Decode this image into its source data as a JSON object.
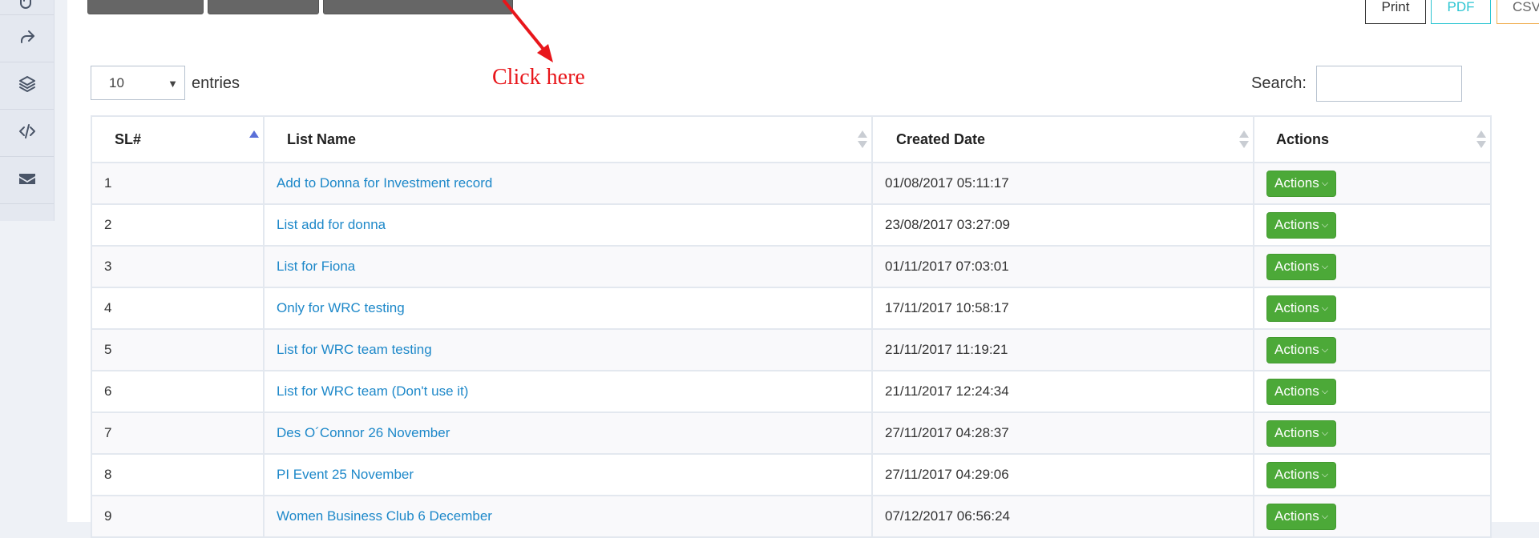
{
  "sidebar": {
    "icons": [
      "paperclip-icon",
      "share-icon",
      "layers-icon",
      "code-icon",
      "mail-icon"
    ]
  },
  "toolbar": {
    "export_buttons": {
      "print": "Print",
      "pdf": "PDF",
      "csv": "CSV"
    }
  },
  "annotation": {
    "text": "Click here",
    "color": "#e8161b"
  },
  "length_control": {
    "value": "10",
    "label": "entries"
  },
  "search": {
    "label": "Search:",
    "value": ""
  },
  "table": {
    "columns": [
      "SL#",
      "List Name",
      "Created Date",
      "Actions"
    ],
    "sorted_column": "SL#",
    "sort_direction": "ascending",
    "rows": [
      {
        "sl": "1",
        "name": "Add to Donna for Investment record",
        "created": "01/08/2017 05:11:17",
        "action": "Actions"
      },
      {
        "sl": "2",
        "name": "List add for donna",
        "created": "23/08/2017 03:27:09",
        "action": "Actions"
      },
      {
        "sl": "3",
        "name": "List for Fiona",
        "created": "01/11/2017 07:03:01",
        "action": "Actions"
      },
      {
        "sl": "4",
        "name": "Only for WRC testing",
        "created": "17/11/2017 10:58:17",
        "action": "Actions"
      },
      {
        "sl": "5",
        "name": "List for WRC team testing",
        "created": "21/11/2017 11:19:21",
        "action": "Actions"
      },
      {
        "sl": "6",
        "name": "List for WRC team (Don't use it)",
        "created": "21/11/2017 12:24:34",
        "action": "Actions"
      },
      {
        "sl": "7",
        "name": "Des O´Connor 26 November",
        "created": "27/11/2017 04:28:37",
        "action": "Actions"
      },
      {
        "sl": "8",
        "name": "PI Event 25 November",
        "created": "27/11/2017 04:29:06",
        "action": "Actions"
      },
      {
        "sl": "9",
        "name": "Women Business Club 6 December",
        "created": "07/12/2017 06:56:24",
        "action": "Actions"
      }
    ]
  },
  "colors": {
    "link": "#1d88c9",
    "action_button": "#4ca938",
    "pdf": "#2cc5d2",
    "csv": "#f0ad4e"
  }
}
